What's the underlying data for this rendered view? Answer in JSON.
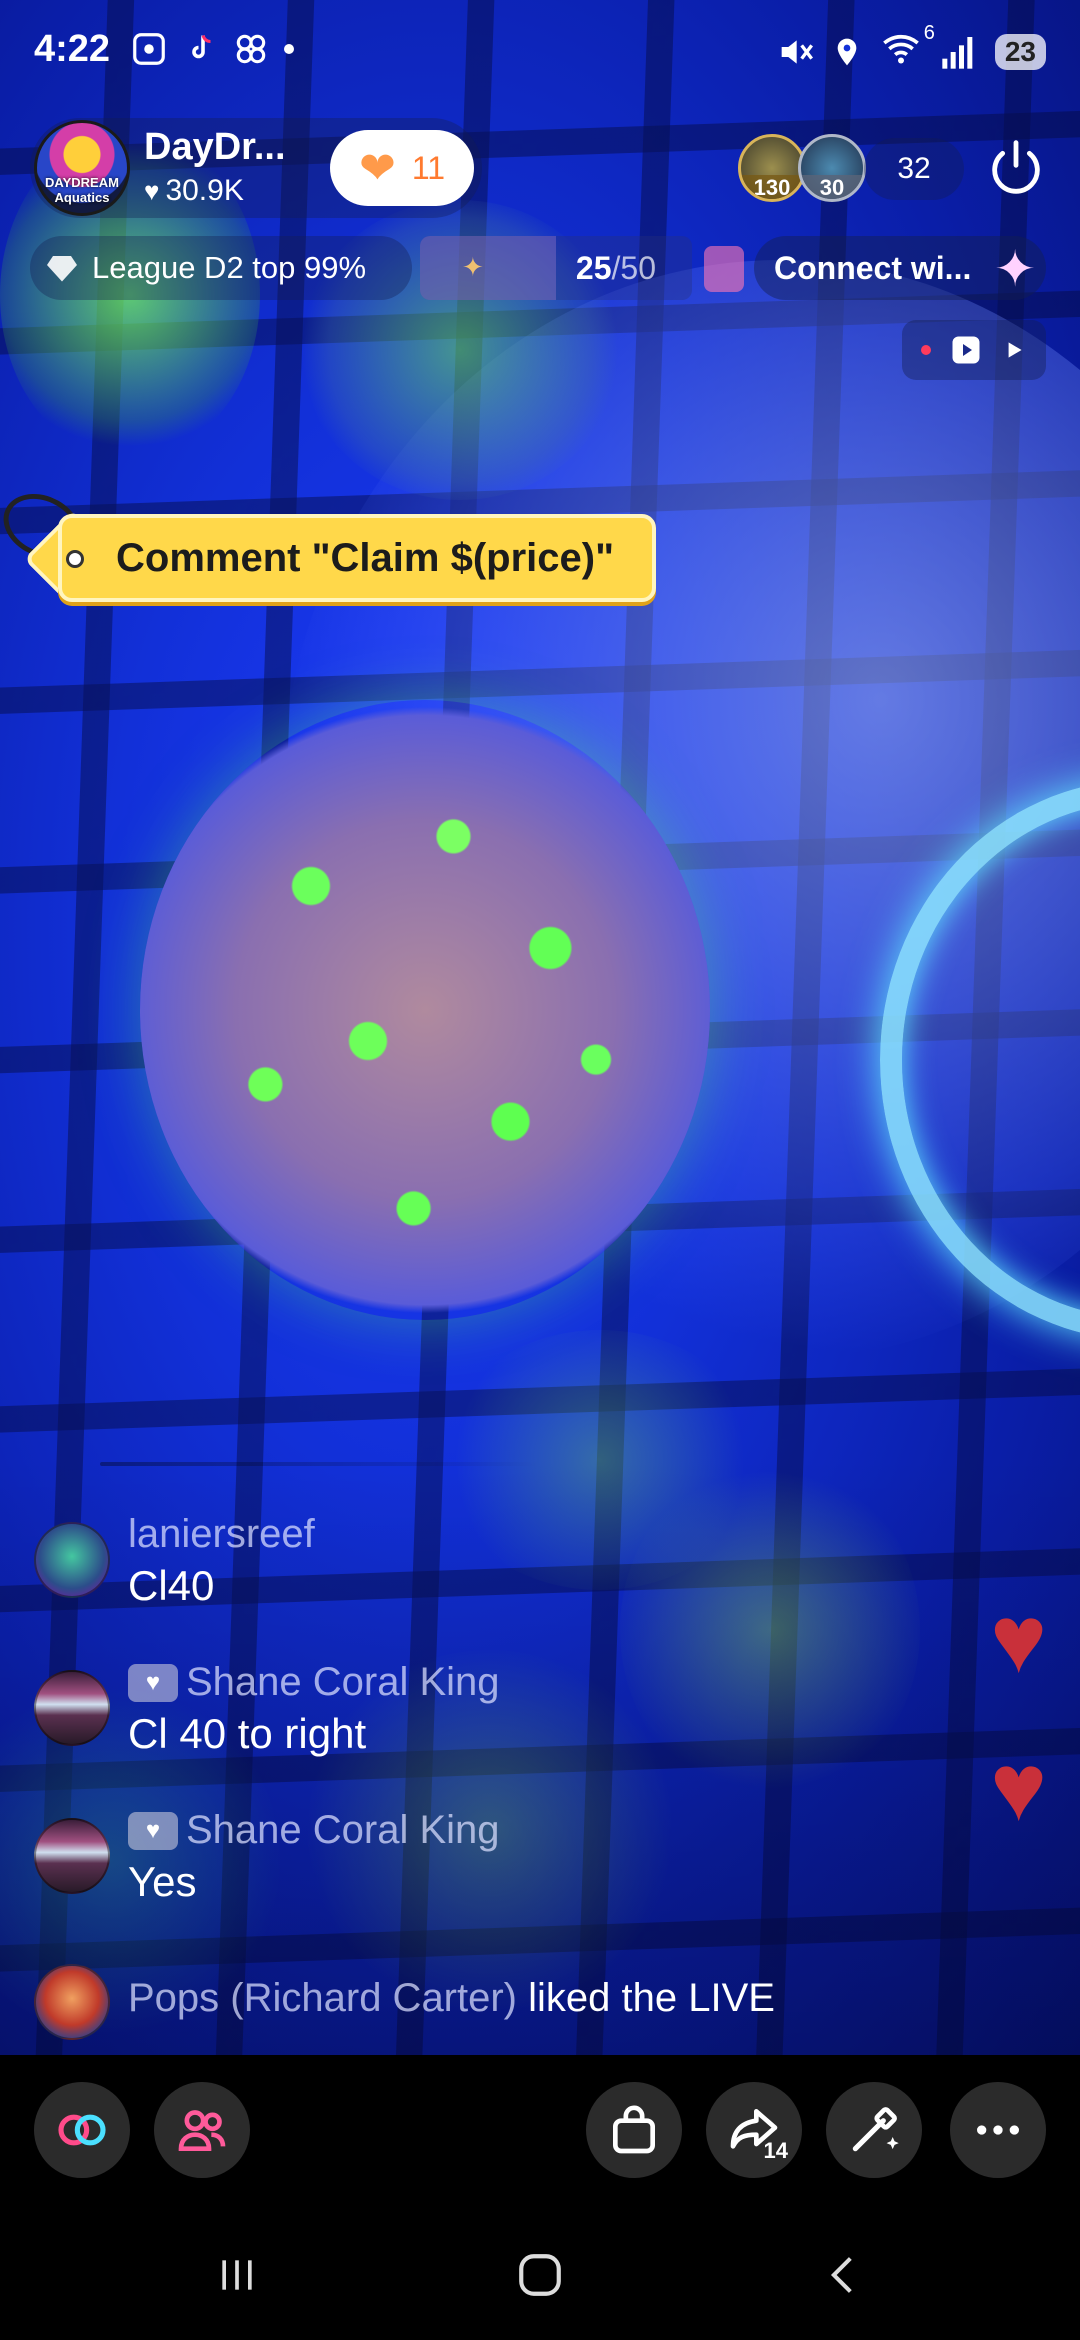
{
  "status_bar": {
    "time": "4:22",
    "network_superscript": "6",
    "battery": "23",
    "icons_left": [
      "screenshot-icon",
      "tiktok-icon",
      "pinwheel-icon",
      "dot-icon"
    ],
    "icons_right": [
      "mute-icon",
      "location-icon",
      "wifi-icon",
      "signal-icon",
      "battery-icon"
    ]
  },
  "host": {
    "name": "DayDr...",
    "likes": "30.9K",
    "logo_text": "DAYDREAM Aquatics",
    "like_button_count": "11"
  },
  "viewers": {
    "top_avatars": [
      {
        "label": "130"
      },
      {
        "label": "30"
      }
    ],
    "count": "32"
  },
  "league": {
    "label": "League D2 top 99%"
  },
  "goal": {
    "current": "25",
    "total": "/50",
    "progress": 0.5
  },
  "connect": {
    "label": "Connect wi..."
  },
  "pinned_comment": {
    "text": "Comment \"Claim $(price)\""
  },
  "comments": [
    {
      "user": "laniersreef",
      "message": "Cl40",
      "has_badge": false
    },
    {
      "user": "Shane Coral King",
      "message": "Cl 40 to right",
      "has_badge": true
    },
    {
      "user": "Shane Coral King",
      "message": "Yes",
      "has_badge": true
    }
  ],
  "activity": {
    "user": "Pops (Richard Carter)",
    "action": " liked the LIVE"
  },
  "toolbar": {
    "share_count": "14",
    "buttons": [
      "link-icon",
      "people-icon",
      "shopping-bag-icon",
      "share-icon",
      "magic-wand-icon",
      "more-icon"
    ]
  },
  "colors": {
    "like_heart": "#ff9a4a",
    "pin_tag": "#ffd84a",
    "floating_heart": "#c9303a",
    "toolbar_button": "#2b2b2b"
  }
}
